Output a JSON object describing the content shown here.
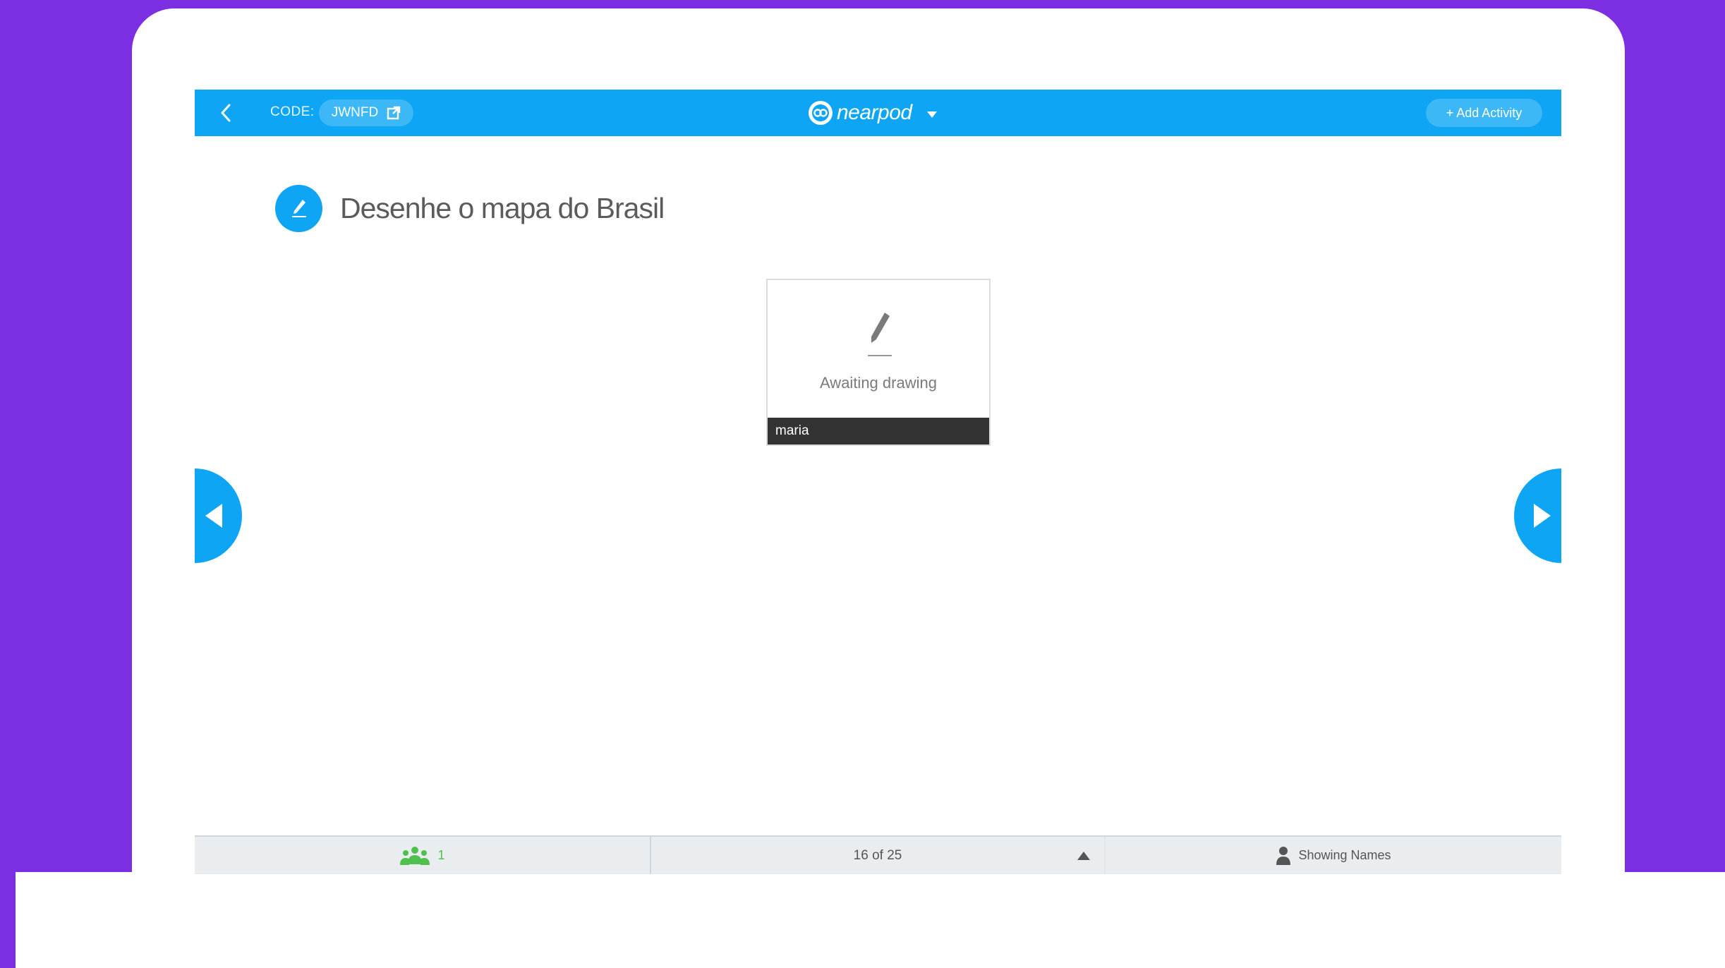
{
  "colors": {
    "background": "#7b2ee2",
    "accent": "#0ea5f5",
    "pill": "#3db8f7",
    "students_green": "#4fbf4f",
    "name_bar": "#333333"
  },
  "topbar": {
    "back_icon": "chevron-left-icon",
    "code_label": "CODE:",
    "code_value": "JWNFD",
    "code_icon": "external-link-icon",
    "brand_name": "nearpod",
    "brand_caret_icon": "caret-down-icon",
    "add_activity_label": "+ Add Activity"
  },
  "slide": {
    "title_icon": "pencil-icon",
    "title": "Desenhe o mapa do Brasil"
  },
  "responses": [
    {
      "status": "Awaiting drawing",
      "student_name": "maria"
    }
  ],
  "navigation": {
    "prev_icon": "arrow-left-icon",
    "next_icon": "arrow-right-icon"
  },
  "bottombar": {
    "students_icon": "students-group-icon",
    "students_count": "1",
    "page_indicator": "16 of 25",
    "page_caret_icon": "caret-up-icon",
    "names_icon": "person-icon",
    "names_label": "Showing Names"
  }
}
